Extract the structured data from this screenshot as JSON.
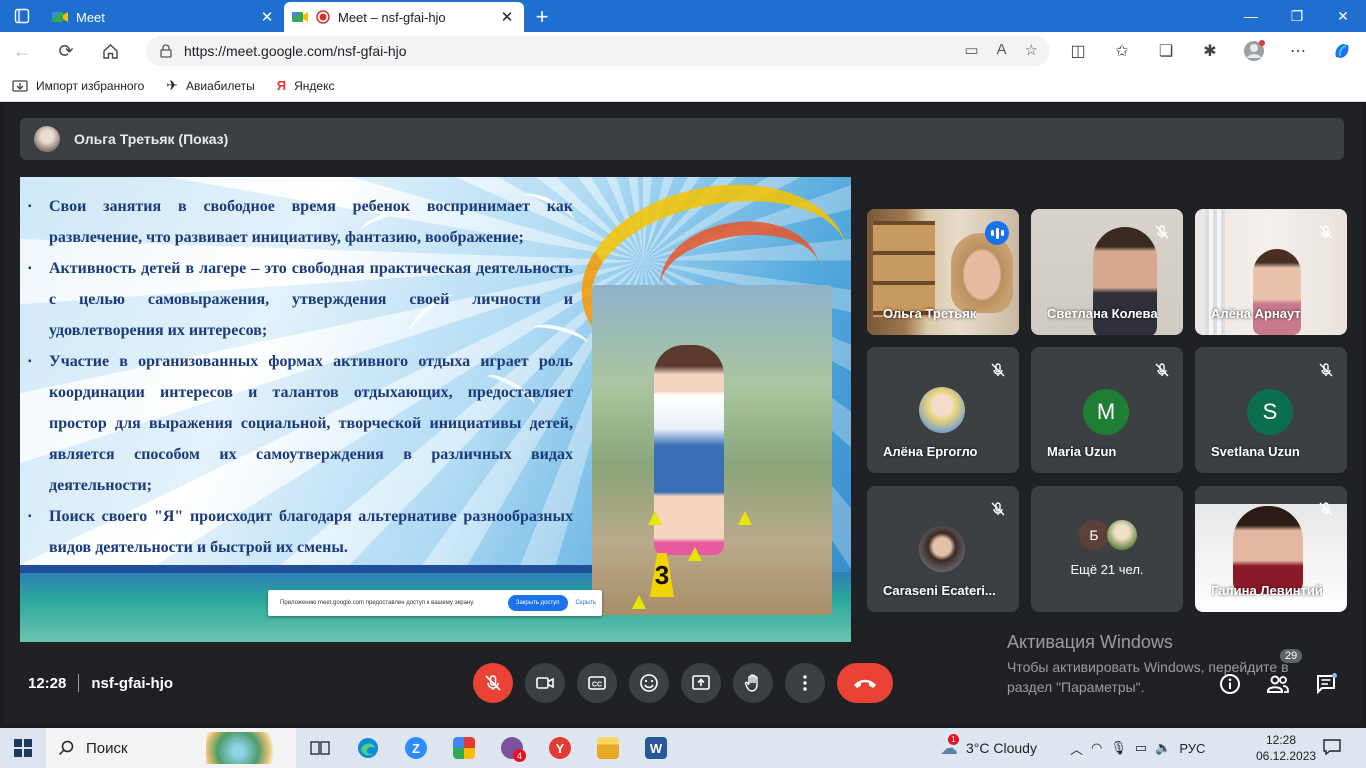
{
  "browser": {
    "tabs": [
      {
        "title": "Meet",
        "active": false
      },
      {
        "title": "Meet – nsf-gfai-hjo",
        "active": true
      }
    ],
    "url": "https://meet.google.com/nsf-gfai-hjo",
    "favorites": [
      {
        "label": "Импорт избранного",
        "icon": "import-icon"
      },
      {
        "label": "Авиабилеты",
        "icon": "plane-icon"
      },
      {
        "label": "Яндекс",
        "icon": "yandex-icon"
      }
    ]
  },
  "meet": {
    "presenter_label": "Ольга Третьяк (Показ)",
    "slide": {
      "bullets": [
        "Свои занятия в свободное время ребенок воспринимает как развлечение, что развивает инициативу, фантазию, воображение;",
        "Активность детей в лагере – это свободная практическая деятельность с целью самовыражения, утверждения своей личности и удовлетворения их интересов;",
        " Участие в организованных формах активного отдыха играет роль координации интересов и талантов отдыхающих, предоставляет простор для выражения социальной, творческой инициативы детей, является способом их самоутверждения в различных видах деятельности;",
        "Поиск своего \"Я\" происходит благодаря альтернативе разнообразных видов деятельности и быстрой их смены."
      ],
      "photo_number": "3",
      "share_notice": "Приложению meet.google.com предоставлен доступ к вашему экрану.",
      "share_button": "Закрыть доступ",
      "share_hide": "Скрыть"
    },
    "participants": [
      {
        "name": "Ольга Третьяк",
        "speaking": true
      },
      {
        "name": "Светлана Колева",
        "muted": true
      },
      {
        "name": "Алёна Арнаут",
        "muted": true
      },
      {
        "name": "Алёна Ергогло",
        "muted": true
      },
      {
        "name": "Maria Uzun",
        "muted": true,
        "initial": "M",
        "color": "#1e7e34"
      },
      {
        "name": "Svetlana Uzun",
        "muted": true,
        "initial": "S",
        "color": "#0b6e4f"
      },
      {
        "name": "Caraseni Ecateri...",
        "muted": true
      },
      {
        "name": "Галина Левинтий",
        "muted": true
      }
    ],
    "more": {
      "initial": "Б",
      "label": "Ещё 21 чел."
    },
    "time": "12:28",
    "meeting_code": "nsf-gfai-hjo",
    "people_count": "29",
    "activation": {
      "title": "Активация Windows",
      "line1": "Чтобы активировать Windows, перейдите в",
      "line2": "раздел \"Параметры\"."
    }
  },
  "taskbar": {
    "search_label": "Поиск",
    "viber_badge": "4",
    "weather_badge": "1",
    "weather": "3°C  Cloudy",
    "lang": "РУС",
    "time": "12:28",
    "date": "06.12.2023"
  },
  "colors": {
    "tab_bar": "#1f6fd1",
    "meet_bg": "#202124",
    "tile_bg": "#3c4043",
    "danger": "#ea4335",
    "accent": "#1a73e8"
  }
}
